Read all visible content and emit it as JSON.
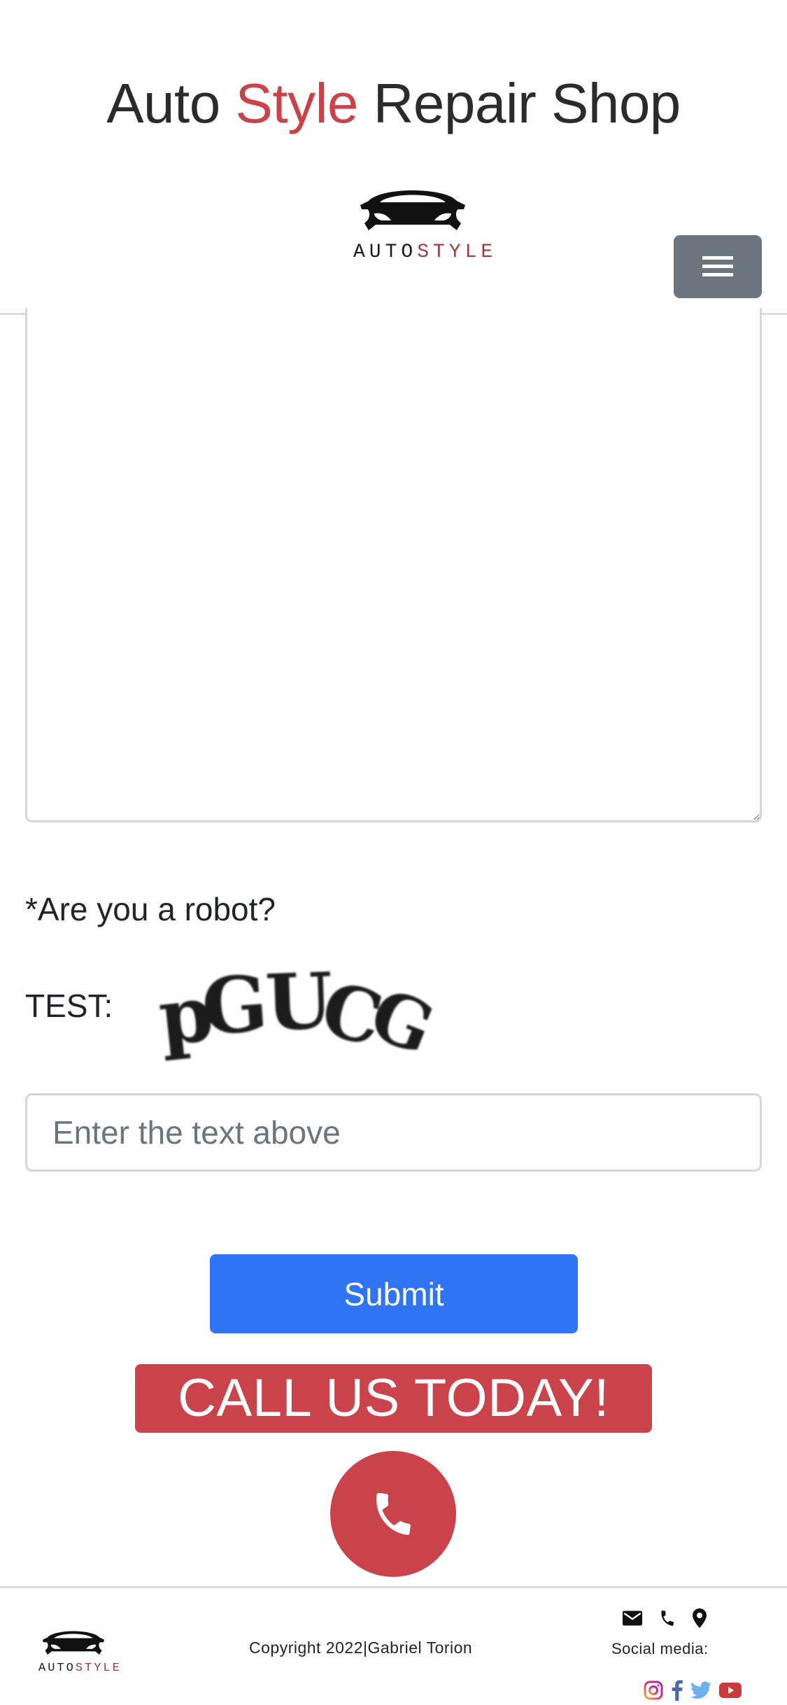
{
  "header": {
    "title_part1": "Auto ",
    "title_accent": "Style",
    "title_part2": " Repair Shop",
    "logo_text_auto": "AUTO",
    "logo_text_style": "STYLE",
    "menu_icon": "hamburger-menu-icon"
  },
  "form": {
    "robot_question": "*Are you a robot?",
    "test_label": "TEST:",
    "captcha_text": "pGUCG",
    "captcha_placeholder": "Enter the text above",
    "submit_label": "Submit"
  },
  "call": {
    "banner_text": "CALL US TODAY!",
    "phone_icon": "phone-icon"
  },
  "footer": {
    "logo_text_auto": "AUTO",
    "logo_text_style": "STYLE",
    "copyright": "Copyright 2022|Gabriel Torion",
    "social_label": "Social media:",
    "contact_icons": [
      "email-icon",
      "phone-icon",
      "location-pin-icon"
    ],
    "social_icons": [
      "instagram-icon",
      "facebook-icon",
      "twitter-icon",
      "youtube-icon"
    ]
  },
  "colors": {
    "accent_red": "#ca434b",
    "submit_blue": "#2f74f5",
    "menu_gray": "#6c757d",
    "facebook": "#4a67ad",
    "twitter": "#6cb0ee",
    "youtube": "#c83b3b"
  }
}
